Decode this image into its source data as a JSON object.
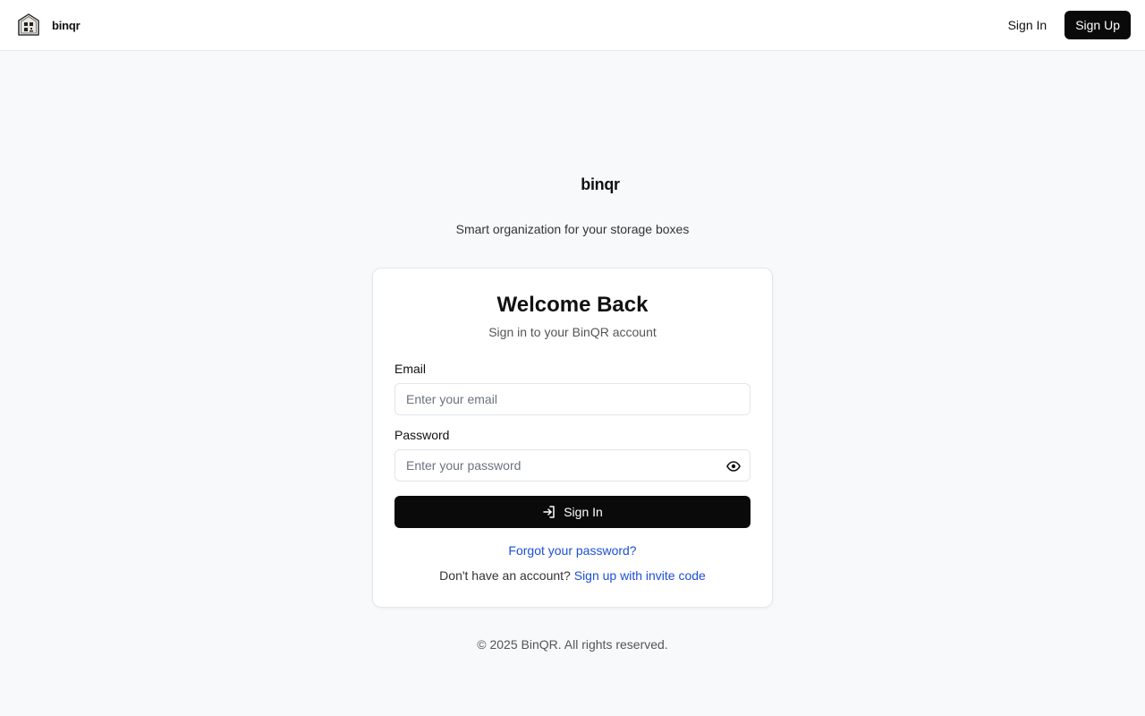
{
  "header": {
    "brand_name": "binqr",
    "brand_icon": "house-qr-logo-icon",
    "signin_label": "Sign In",
    "signup_label": "Sign Up"
  },
  "hero": {
    "logo_text": "binqr",
    "tagline": "Smart organization for your storage boxes"
  },
  "login_card": {
    "title": "Welcome Back",
    "subtitle": "Sign in to your BinQR account",
    "email": {
      "label": "Email",
      "placeholder": "Enter your email",
      "value": ""
    },
    "password": {
      "label": "Password",
      "placeholder": "Enter your password",
      "value": "",
      "toggle_icon": "eye-icon"
    },
    "submit_label": "Sign In",
    "submit_icon": "login-arrow-icon",
    "forgot_label": "Forgot your password?",
    "signup_prompt": "Don't have an account?",
    "signup_link": "Sign up with invite code"
  },
  "footer": {
    "copyright": "© 2025 BinQR. All rights reserved."
  },
  "colors": {
    "background": "#f7f9fb",
    "primary_button": "#0a0a0a",
    "link": "#1d4ed8",
    "border": "#e5e7eb"
  }
}
